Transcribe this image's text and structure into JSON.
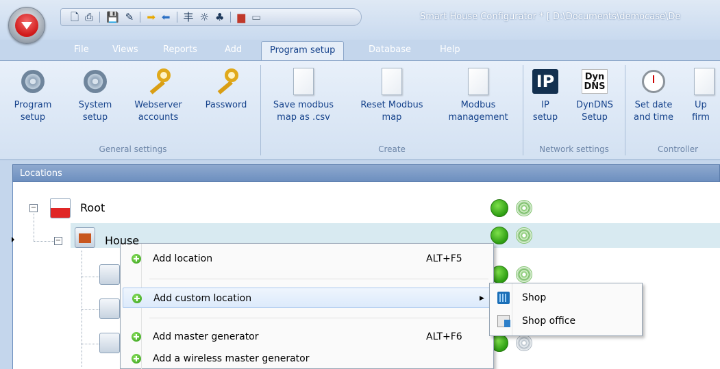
{
  "window": {
    "title": "Smart House Configurator * [ D:\\Documents\\democase\\De"
  },
  "quick_access": {
    "icons": [
      "new-file-icon",
      "print-icon",
      "save-icon",
      "edit-icon",
      "import-icon",
      "export-icon",
      "filter-icon",
      "antenna-icon",
      "network-icon",
      "color-icon",
      "monitor-icon"
    ]
  },
  "menu_tabs": [
    {
      "label": "File"
    },
    {
      "label": "Views"
    },
    {
      "label": "Reports"
    },
    {
      "label": "Add"
    },
    {
      "label": "Program setup",
      "active": true
    },
    {
      "label": "Database"
    },
    {
      "label": "Help"
    }
  ],
  "ribbon": {
    "buttons": [
      {
        "label1": "Program",
        "label2": "setup",
        "icon": "gear-icon"
      },
      {
        "label1": "System",
        "label2": "setup",
        "icon": "gear-icon"
      },
      {
        "label1": "Webserver",
        "label2": "accounts",
        "icon": "key-icon"
      },
      {
        "label1": "Password",
        "label2": "",
        "icon": "key-icon"
      },
      {
        "label1": "Save modbus",
        "label2": "map as .csv",
        "icon": "document-icon"
      },
      {
        "label1": "Reset Modbus",
        "label2": "map",
        "icon": "document-icon"
      },
      {
        "label1": "Modbus",
        "label2": "management",
        "icon": "document-icon"
      },
      {
        "label1": "IP",
        "label2": "setup",
        "icon": "ip-icon",
        "icon_text": "IP"
      },
      {
        "label1": "DynDNS",
        "label2": "Setup",
        "icon": "dyndns-icon",
        "icon_text1": "Dyn",
        "icon_text2": "DNS"
      },
      {
        "label1": "Set date",
        "label2": "and time",
        "icon": "alarm-clock-icon"
      },
      {
        "label1": "Up",
        "label2": "firm",
        "icon": "document-icon"
      }
    ],
    "groups": [
      {
        "label": "General settings"
      },
      {
        "label": "Create"
      },
      {
        "label": "Network settings"
      },
      {
        "label": "Controller"
      }
    ]
  },
  "locations_panel": {
    "title": "Locations",
    "tree": [
      {
        "label": "Root",
        "status": "online",
        "signal": "green"
      },
      {
        "label": "House",
        "status": "online",
        "signal": "green",
        "selected": true
      }
    ]
  },
  "context_menu": {
    "items": [
      {
        "label": "Add location",
        "shortcut": "ALT+F5"
      },
      {
        "label": "Add custom location",
        "shortcut": "",
        "submenu": true
      },
      {
        "label": "Add master generator",
        "shortcut": "ALT+F6"
      },
      {
        "label": "Add a wireless master generator",
        "shortcut": ""
      }
    ],
    "submenu": [
      {
        "label": "Shop",
        "icon": "building-icon"
      },
      {
        "label": "Shop office",
        "icon": "office-icon"
      }
    ]
  },
  "colors": {
    "ribbon_bg": "#d3e1f2",
    "accent_red": "#d01919",
    "status_green": "#2d9d12",
    "selected_row": "#d8eaf1"
  }
}
